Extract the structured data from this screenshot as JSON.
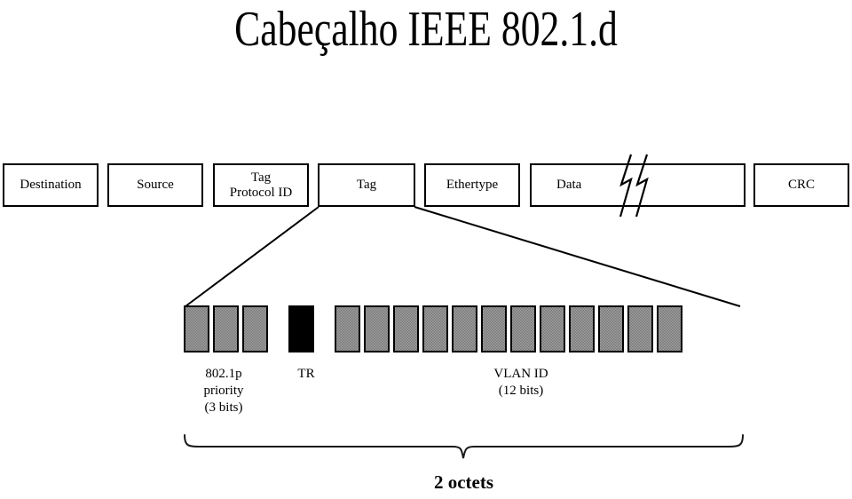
{
  "slide": {
    "title": "Cabeçalho IEEE 802.1.d",
    "background_color": "#ffffff",
    "ink_color": "#000000",
    "cell_fill_color": "#9d9d9d",
    "cell_black_color": "#000000"
  },
  "frame": {
    "fields": [
      {
        "id": "destination",
        "label": "Destination"
      },
      {
        "id": "source",
        "label": "Source"
      },
      {
        "id": "tag_protocol_id",
        "label": "Tag\nProtocol ID"
      },
      {
        "id": "tag",
        "label": "Tag"
      },
      {
        "id": "ethertype",
        "label": "Ethertype"
      },
      {
        "id": "data",
        "label": "Data"
      },
      {
        "id": "crc",
        "label": "CRC"
      }
    ]
  },
  "tag_expansion": {
    "total_cells": 16,
    "groups": [
      {
        "id": "priority",
        "cells": 3,
        "fill": "gray",
        "caption": "802.1p\npriority\n(3 bits)"
      },
      {
        "id": "tr",
        "cells": 1,
        "fill": "black",
        "caption": "TR"
      },
      {
        "id": "vlan_id",
        "cells": 12,
        "fill": "gray",
        "caption": "VLAN ID\n(12 bits)"
      }
    ],
    "size_label": "2 octets"
  }
}
